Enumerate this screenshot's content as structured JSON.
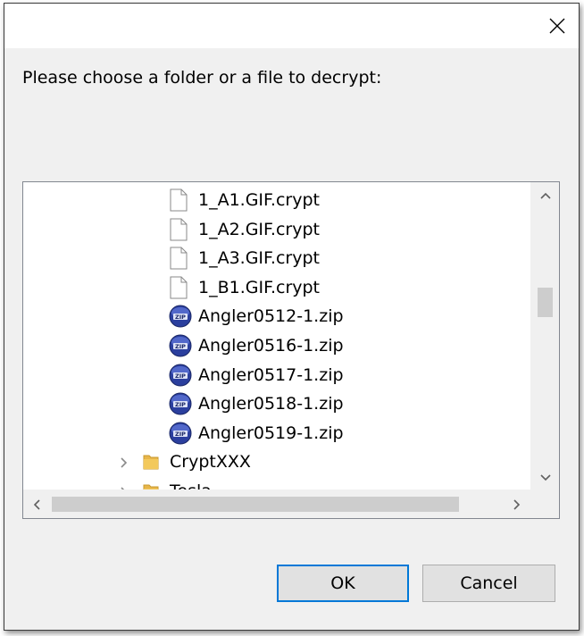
{
  "dialog": {
    "prompt": "Please choose a folder or a file to decrypt:",
    "close_icon": "close-icon"
  },
  "tree": {
    "items": [
      {
        "label": "1_A1.GIF.crypt",
        "icon": "file-icon"
      },
      {
        "label": "1_A2.GIF.crypt",
        "icon": "file-icon"
      },
      {
        "label": "1_A3.GIF.crypt",
        "icon": "file-icon"
      },
      {
        "label": "1_B1.GIF.crypt",
        "icon": "file-icon"
      },
      {
        "label": "Angler0512-1.zip",
        "icon": "zip-archive-icon"
      },
      {
        "label": "Angler0516-1.zip",
        "icon": "zip-archive-icon"
      },
      {
        "label": "Angler0517-1.zip",
        "icon": "zip-archive-icon"
      },
      {
        "label": "Angler0518-1.zip",
        "icon": "zip-archive-icon"
      },
      {
        "label": "Angler0519-1.zip",
        "icon": "zip-archive-icon"
      },
      {
        "label": "CryptXXX",
        "icon": "folder-icon",
        "expandable": true
      },
      {
        "label": "Tesla",
        "icon": "folder-icon",
        "expandable": true
      }
    ]
  },
  "buttons": {
    "ok": "OK",
    "cancel": "Cancel"
  },
  "colors": {
    "dialog_bg": "#f0f0f0",
    "accent_focus": "#0078d7",
    "folder": "#e8b64a"
  }
}
